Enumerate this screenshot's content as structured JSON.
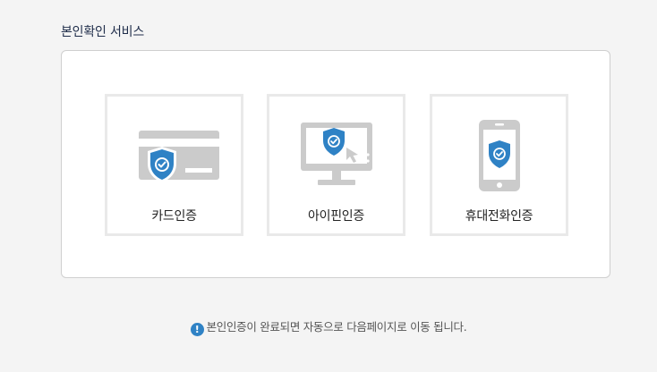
{
  "section": {
    "title": "본인확인 서비스"
  },
  "cards": [
    {
      "label": "카드인증",
      "icon": "card-shield-icon"
    },
    {
      "label": "아이핀인증",
      "icon": "monitor-shield-icon"
    },
    {
      "label": "휴대전화인증",
      "icon": "phone-shield-icon"
    }
  ],
  "notice": {
    "icon": "info-icon",
    "icon_glyph": "!",
    "text": "본인인증이 완료되면 자동으로 다음페이지로 이동 됩니다."
  },
  "colors": {
    "accent": "#2f82c5",
    "icon_gray": "#cbcbcb",
    "title": "#1f2d4a"
  }
}
